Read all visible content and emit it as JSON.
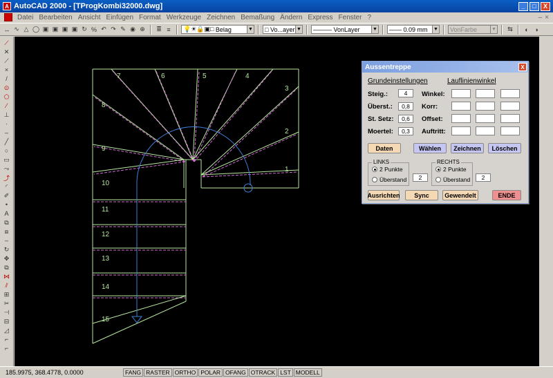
{
  "window": {
    "title": "AutoCAD 2000 - [TProgKombi32000.dwg]",
    "minimize": "_",
    "maximize": "□",
    "close": "X"
  },
  "menu": [
    "Datei",
    "Bearbeiten",
    "Ansicht",
    "Einfügen",
    "Format",
    "Werkzeuge",
    "Zeichnen",
    "Bemaßung",
    "Ändern",
    "Express",
    "Fenster",
    "?"
  ],
  "mdi_buttons": [
    "–",
    "×"
  ],
  "toolbar": {
    "layer_name": "Belag",
    "color": "Vo...ayer",
    "linetype": "VonLayer",
    "lineweight": "0.09 mm",
    "plotstyle": "VonFarbe"
  },
  "status": {
    "coords": "185.9975, 368.4778, 0.0000",
    "toggles": [
      "FANG",
      "RASTER",
      "ORTHO",
      "POLAR",
      "OFANG",
      "OTRACK",
      "LST",
      "MODELL"
    ]
  },
  "drawing": {
    "step_numbers": [
      "1",
      "2",
      "3",
      "4",
      "5",
      "6",
      "7",
      "8",
      "9",
      "10",
      "11",
      "12",
      "13",
      "14",
      "15"
    ]
  },
  "dialog": {
    "title": "Aussentreppe",
    "close": "X",
    "heading_left": "Grundeinstellungen",
    "heading_right": "Lauflinienwinkel",
    "fields": [
      {
        "label": "Steig.:",
        "value": "4"
      },
      {
        "label": "Überst.:",
        "value": "0,8"
      },
      {
        "label": "St. Setz:",
        "value": "0,6"
      },
      {
        "label": "Moertel:",
        "value": "0,3"
      }
    ],
    "right_labels": [
      "Winkel:",
      "Korr:",
      "Offset:",
      "Auftritt:"
    ],
    "buttons": {
      "daten": "Daten",
      "waehlen": "Wählen",
      "zeichnen": "Zeichnen",
      "loeschen": "Löschen",
      "ausrichten": "Ausrichten",
      "sync": "Sync",
      "gewendelt": "Gewendelt",
      "ende": "ENDE"
    },
    "links": {
      "label": "LINKS",
      "option1": "2 Punkte",
      "option2": "Überstand",
      "value": "2"
    },
    "rechts": {
      "label": "RECHTS",
      "option1": "2 Punkte",
      "option2": "Überstand",
      "value": "2"
    }
  }
}
